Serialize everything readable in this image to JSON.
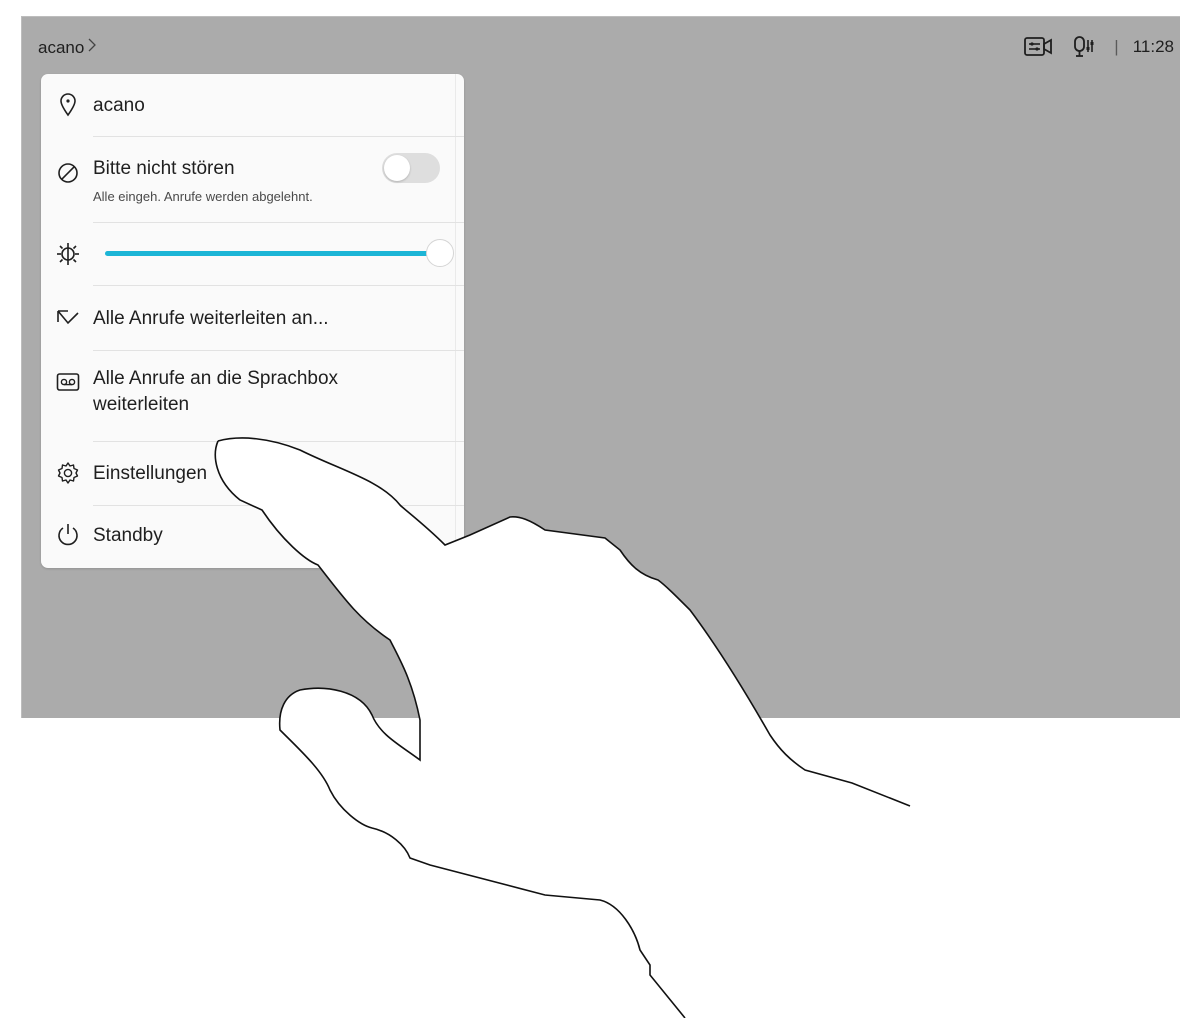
{
  "header": {
    "breadcrumb_label": "acano",
    "chevron": ">",
    "status_icons": [
      "camera-controls-icon",
      "microphone-settings-icon"
    ],
    "separator": "|",
    "time": "11:28"
  },
  "menu": {
    "items": [
      {
        "id": "location",
        "icon": "location-pin-icon",
        "label": "acano"
      },
      {
        "id": "dnd",
        "icon": "do-not-disturb-icon",
        "label": "Bitte nicht stören",
        "sublabel": "Alle eingeh. Anrufe werden abgelehnt.",
        "toggle_on": false
      },
      {
        "id": "brightness",
        "icon": "brightness-icon",
        "slider_level": 1.0
      },
      {
        "id": "forward",
        "icon": "forward-call-icon",
        "label": "Alle Anrufe weiterleiten an..."
      },
      {
        "id": "voicemail",
        "icon": "voicemail-icon",
        "label_line1": "Alle Anrufe an die Sprachbox",
        "label_line2": "weiterleiten"
      },
      {
        "id": "settings",
        "icon": "gear-icon",
        "label": "Einstellungen"
      },
      {
        "id": "standby",
        "icon": "power-icon",
        "label": "Standby"
      }
    ]
  },
  "colors": {
    "screen_bg": "#ababab",
    "panel_bg": "#fafafa",
    "slider_accent": "#1cb5d6",
    "toggle_off": "#dedede"
  },
  "overlay": {
    "icon": "hand-pointer-icon"
  }
}
